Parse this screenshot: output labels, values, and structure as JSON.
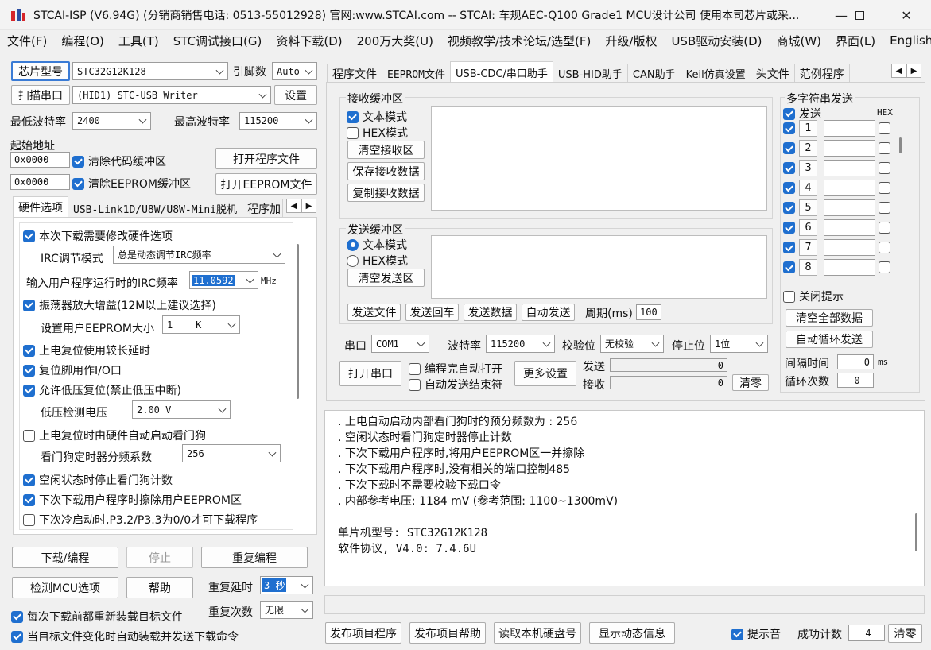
{
  "window": {
    "title": "STCAI-ISP (V6.94G) (分销商销售电话: 0513-55012928) 官网:www.STCAI.com  -- STCAI: 车规AEC-Q100 Grade1 MCU设计公司 使用本司芯片或采...",
    "minimize": "—",
    "maximize": "☐",
    "close": "✕"
  },
  "menu": [
    "文件(F)",
    "编程(O)",
    "工具(T)",
    "STC调试接口(G)",
    "资料下载(D)",
    "200万大奖(U)",
    "视频教学/技术论坛/选型(F)",
    "升级/版权",
    "USB驱动安装(D)",
    "商城(W)",
    "界面(L)",
    "English"
  ],
  "left": {
    "chip_btn": "芯片型号",
    "chip_value": "STC32G12K128",
    "pins_label": "引脚数",
    "pins_value": "Auto",
    "scan_btn": "扫描串口",
    "port_value": "(HID1) STC-USB Writer",
    "settings_btn": "设置",
    "min_baud_label": "最低波特率",
    "min_baud_value": "2400",
    "max_baud_label": "最高波特率",
    "max_baud_value": "115200",
    "start_addr_label": "起始地址",
    "addr1": "0x0000",
    "clear_code": "清除代码缓冲区",
    "open_prog": "打开程序文件",
    "addr2": "0x0000",
    "clear_eeprom": "清除EEPROM缓冲区",
    "open_eeprom": "打开EEPROM文件",
    "tabs": [
      "硬件选项",
      "USB-Link1D/U8W/U8W-Mini脱机",
      "程序加"
    ],
    "hw": {
      "opt1": "本次下载需要修改硬件选项",
      "irc_mode_label": "IRC调节模式",
      "irc_mode_value": "总是动态调节IRC频率",
      "irc_freq_label": "输入用户程序运行时的IRC频率",
      "irc_freq_value": "11.0592",
      "irc_unit": "MHz",
      "opt2": "振荡器放大增益(12M以上建议选择)",
      "eeprom_size_label": "设置用户EEPROM大小",
      "eeprom_size_value": "1    K",
      "opt3": "上电复位使用较长延时",
      "opt4": "复位脚用作I/O口",
      "opt5": "允许低压复位(禁止低压中断)",
      "lvd_label": "低压检测电压",
      "lvd_value": "2.00 V",
      "opt6": "上电复位时由硬件自动启动看门狗",
      "wdt_label": "看门狗定时器分频系数",
      "wdt_value": "256",
      "opt7": "空闲状态时停止看门狗计数",
      "opt8": "下次下载用户程序时擦除用户EEPROM区",
      "opt9": "下次冷启动时,P3.2/P3.3为0/0才可下载程序"
    },
    "download_btn": "下载/编程",
    "stop_btn": "停止",
    "repeat_btn": "重复编程",
    "check_btn": "检测MCU选项",
    "help_btn": "帮助",
    "repeat_delay_label": "重复延时",
    "repeat_delay_value": "3 秒",
    "repeat_count_label": "重复次数",
    "repeat_count_value": "无限",
    "reload_cb": "每次下载前都重新装载目标文件",
    "auto_cb": "当目标文件变化时自动装载并发送下载命令"
  },
  "right": {
    "tabs": [
      "程序文件",
      "EEPROM文件",
      "USB-CDC/串口助手",
      "USB-HID助手",
      "CAN助手",
      "Keil仿真设置",
      "头文件",
      "范例程序"
    ],
    "recv_title": "接收缓冲区",
    "text_mode": "文本模式",
    "hex_mode": "HEX模式",
    "clear_recv": "清空接收区",
    "save_recv": "保存接收数据",
    "copy_recv": "复制接收数据",
    "send_title": "发送缓冲区",
    "send_text_mode": "文本模式",
    "send_hex_mode": "HEX模式",
    "clear_send": "清空发送区",
    "send_file": "发送文件",
    "send_back": "发送回车",
    "send_data": "发送数据",
    "auto_send": "自动发送",
    "period_label": "周期(ms)",
    "period_value": "100",
    "multi_title": "多字符串发送",
    "multi_send": "发送",
    "hex_header": "HEX",
    "multi_rows": [
      "1",
      "2",
      "3",
      "4",
      "5",
      "6",
      "7",
      "8"
    ],
    "close_tip": "关闭提示",
    "clear_all": "清空全部数据",
    "auto_loop": "自动循环发送",
    "interval_label": "间隔时间",
    "interval_value": "0",
    "interval_unit": "ms",
    "loop_label": "循环次数",
    "loop_value": "0",
    "port_label": "串口",
    "port_value": "COM1",
    "baud_label": "波特率",
    "baud_value": "115200",
    "parity_label": "校验位",
    "parity_value": "无校验",
    "stop_label": "停止位",
    "stop_value": "1位",
    "open_port": "打开串口",
    "auto_open": "编程完自动打开",
    "auto_end": "自动发送结束符",
    "more_settings": "更多设置",
    "tx_label": "发送",
    "tx_value": "0",
    "rx_label": "接收",
    "rx_value": "0",
    "clear_zero": "清零"
  },
  "log": [
    ". 上电自动启动内部看门狗时的预分频数为 : 256",
    ". 空闲状态时看门狗定时器停止计数",
    ". 下次下载用户程序时,将用户EEPROM区一并擦除",
    ". 下次下载用户程序时,没有相关的端口控制485",
    ". 下次下载时不需要校验下载口令",
    ". 内部参考电压: 1184 mV (参考范围: 1100~1300mV)",
    "",
    "单片机型号: STC32G12K128",
    "软件协议, V4.0: 7.4.6U"
  ],
  "bottom": {
    "publish_prog": "发布项目程序",
    "publish_help": "发布项目帮助",
    "read_disk": "读取本机硬盘号",
    "show_dynamic": "显示动态信息",
    "beep": "提示音",
    "success_label": "成功计数",
    "success_value": "4",
    "clear": "清零"
  }
}
